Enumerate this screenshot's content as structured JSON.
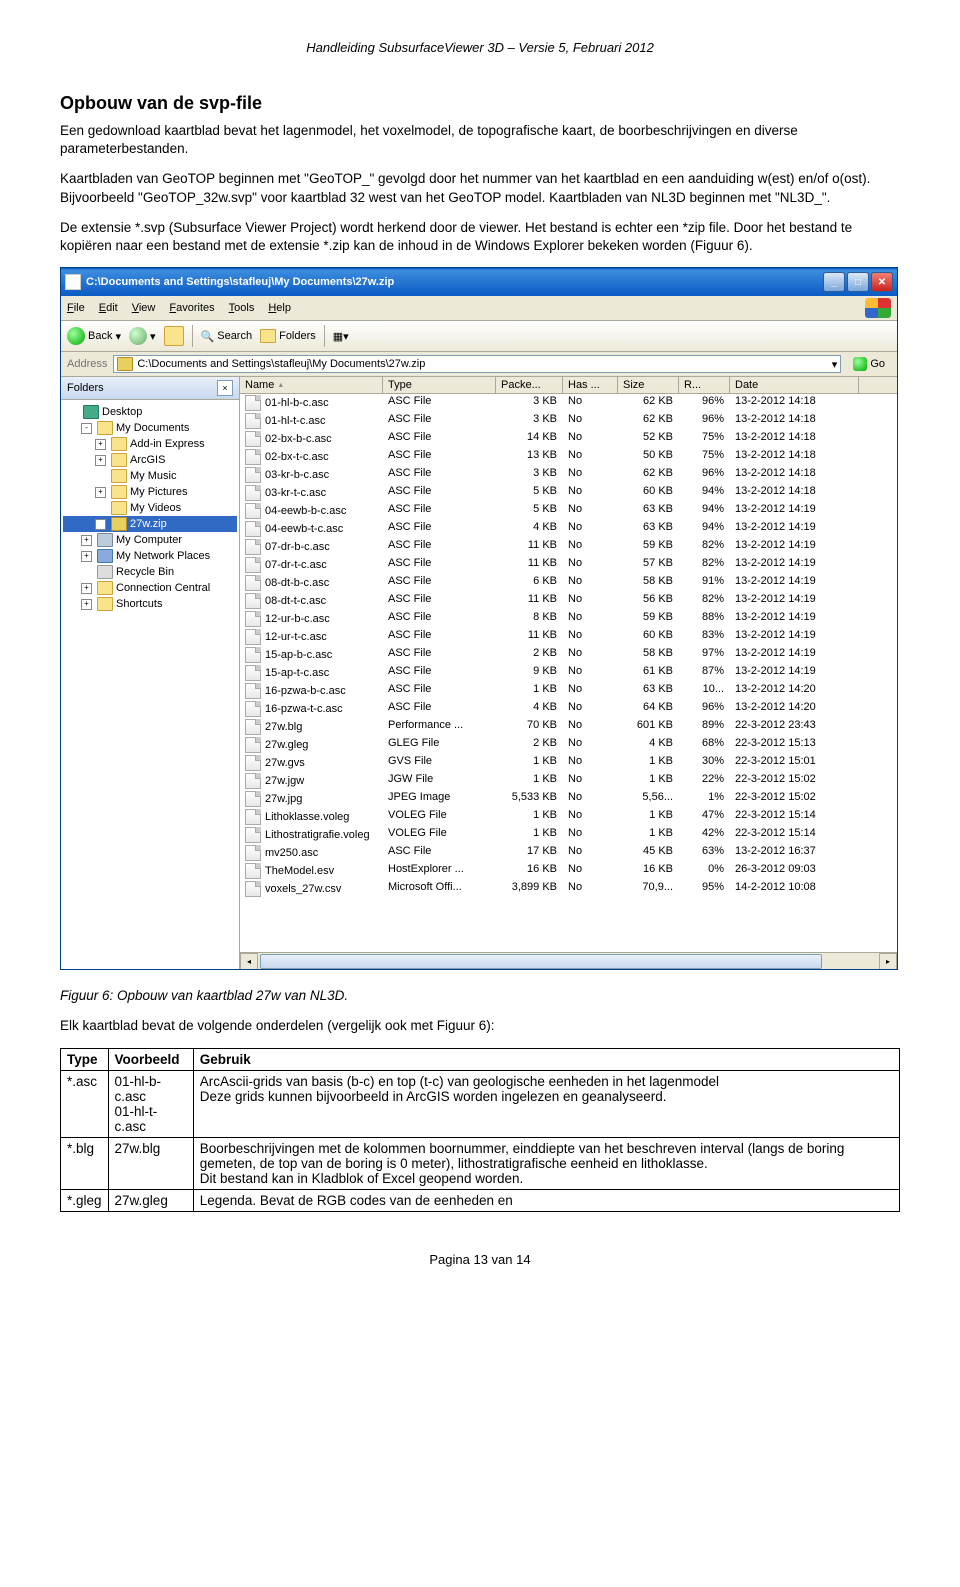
{
  "doc_header": "Handleiding SubsurfaceViewer 3D – Versie 5, Februari 2012",
  "heading": "Opbouw van de svp-file",
  "para1": "Een gedownload kaartblad bevat het lagenmodel, het voxelmodel, de topografische kaart, de boorbeschrijvingen en diverse parameterbestanden.",
  "para2": "Kaartbladen van GeoTOP beginnen met \"GeoTOP_\" gevolgd door het nummer van het kaartblad en een aanduiding w(est) en/of o(ost). Bijvoorbeeld \"GeoTOP_32w.svp\" voor kaartblad 32 west van het GeoTOP model. Kaartbladen van NL3D beginnen met \"NL3D_\".",
  "para3": "De extensie *.svp (Subsurface Viewer Project) wordt herkend door de viewer. Het bestand is echter een *zip file. Door het bestand te kopiëren naar een bestand met de extensie *.zip kan de inhoud in de Windows Explorer bekeken worden (Figuur 6).",
  "explorer": {
    "title": "C:\\Documents and Settings\\stafleuj\\My Documents\\27w.zip",
    "menu": [
      "File",
      "Edit",
      "View",
      "Favorites",
      "Tools",
      "Help"
    ],
    "toolbar_back": "Back",
    "toolbar_search": "Search",
    "toolbar_folders": "Folders",
    "address_label": "Address",
    "address_value": "C:\\Documents and Settings\\stafleuj\\My Documents\\27w.zip",
    "go_label": "Go",
    "folders_pane_title": "Folders",
    "tree": [
      {
        "d": 1,
        "exp": "",
        "ico": "desk",
        "label": "Desktop"
      },
      {
        "d": 2,
        "exp": "-",
        "ico": "f",
        "label": "My Documents"
      },
      {
        "d": 3,
        "exp": "+",
        "ico": "f",
        "label": "Add-in Express"
      },
      {
        "d": 3,
        "exp": "+",
        "ico": "f",
        "label": "ArcGIS"
      },
      {
        "d": 3,
        "exp": "",
        "ico": "f",
        "label": "My Music"
      },
      {
        "d": 3,
        "exp": "+",
        "ico": "f",
        "label": "My Pictures"
      },
      {
        "d": 3,
        "exp": "",
        "ico": "f",
        "label": "My Videos"
      },
      {
        "d": 3,
        "exp": "+",
        "ico": "zip",
        "label": "27w.zip",
        "sel": true
      },
      {
        "d": 2,
        "exp": "+",
        "ico": "comp",
        "label": "My Computer"
      },
      {
        "d": 2,
        "exp": "+",
        "ico": "net",
        "label": "My Network Places"
      },
      {
        "d": 2,
        "exp": "",
        "ico": "bin",
        "label": "Recycle Bin"
      },
      {
        "d": 2,
        "exp": "+",
        "ico": "f",
        "label": "Connection Central"
      },
      {
        "d": 2,
        "exp": "+",
        "ico": "f",
        "label": "Shortcuts"
      }
    ],
    "columns": [
      "Name",
      "Type",
      "Packe...",
      "Has ...",
      "Size",
      "R...",
      "Date"
    ],
    "files": [
      {
        "n": "01-hl-b-c.asc",
        "t": "ASC File",
        "p": "3 KB",
        "h": "No",
        "s": "62 KB",
        "r": "96%",
        "d": "13-2-2012 14:18"
      },
      {
        "n": "01-hl-t-c.asc",
        "t": "ASC File",
        "p": "3 KB",
        "h": "No",
        "s": "62 KB",
        "r": "96%",
        "d": "13-2-2012 14:18"
      },
      {
        "n": "02-bx-b-c.asc",
        "t": "ASC File",
        "p": "14 KB",
        "h": "No",
        "s": "52 KB",
        "r": "75%",
        "d": "13-2-2012 14:18"
      },
      {
        "n": "02-bx-t-c.asc",
        "t": "ASC File",
        "p": "13 KB",
        "h": "No",
        "s": "50 KB",
        "r": "75%",
        "d": "13-2-2012 14:18"
      },
      {
        "n": "03-kr-b-c.asc",
        "t": "ASC File",
        "p": "3 KB",
        "h": "No",
        "s": "62 KB",
        "r": "96%",
        "d": "13-2-2012 14:18"
      },
      {
        "n": "03-kr-t-c.asc",
        "t": "ASC File",
        "p": "5 KB",
        "h": "No",
        "s": "60 KB",
        "r": "94%",
        "d": "13-2-2012 14:18"
      },
      {
        "n": "04-eewb-b-c.asc",
        "t": "ASC File",
        "p": "5 KB",
        "h": "No",
        "s": "63 KB",
        "r": "94%",
        "d": "13-2-2012 14:19"
      },
      {
        "n": "04-eewb-t-c.asc",
        "t": "ASC File",
        "p": "4 KB",
        "h": "No",
        "s": "63 KB",
        "r": "94%",
        "d": "13-2-2012 14:19"
      },
      {
        "n": "07-dr-b-c.asc",
        "t": "ASC File",
        "p": "11 KB",
        "h": "No",
        "s": "59 KB",
        "r": "82%",
        "d": "13-2-2012 14:19"
      },
      {
        "n": "07-dr-t-c.asc",
        "t": "ASC File",
        "p": "11 KB",
        "h": "No",
        "s": "57 KB",
        "r": "82%",
        "d": "13-2-2012 14:19"
      },
      {
        "n": "08-dt-b-c.asc",
        "t": "ASC File",
        "p": "6 KB",
        "h": "No",
        "s": "58 KB",
        "r": "91%",
        "d": "13-2-2012 14:19"
      },
      {
        "n": "08-dt-t-c.asc",
        "t": "ASC File",
        "p": "11 KB",
        "h": "No",
        "s": "56 KB",
        "r": "82%",
        "d": "13-2-2012 14:19"
      },
      {
        "n": "12-ur-b-c.asc",
        "t": "ASC File",
        "p": "8 KB",
        "h": "No",
        "s": "59 KB",
        "r": "88%",
        "d": "13-2-2012 14:19"
      },
      {
        "n": "12-ur-t-c.asc",
        "t": "ASC File",
        "p": "11 KB",
        "h": "No",
        "s": "60 KB",
        "r": "83%",
        "d": "13-2-2012 14:19"
      },
      {
        "n": "15-ap-b-c.asc",
        "t": "ASC File",
        "p": "2 KB",
        "h": "No",
        "s": "58 KB",
        "r": "97%",
        "d": "13-2-2012 14:19"
      },
      {
        "n": "15-ap-t-c.asc",
        "t": "ASC File",
        "p": "9 KB",
        "h": "No",
        "s": "61 KB",
        "r": "87%",
        "d": "13-2-2012 14:19"
      },
      {
        "n": "16-pzwa-b-c.asc",
        "t": "ASC File",
        "p": "1 KB",
        "h": "No",
        "s": "63 KB",
        "r": "10...",
        "d": "13-2-2012 14:20"
      },
      {
        "n": "16-pzwa-t-c.asc",
        "t": "ASC File",
        "p": "4 KB",
        "h": "No",
        "s": "64 KB",
        "r": "96%",
        "d": "13-2-2012 14:20"
      },
      {
        "n": "27w.blg",
        "t": "Performance ...",
        "p": "70 KB",
        "h": "No",
        "s": "601 KB",
        "r": "89%",
        "d": "22-3-2012 23:43"
      },
      {
        "n": "27w.gleg",
        "t": "GLEG File",
        "p": "2 KB",
        "h": "No",
        "s": "4 KB",
        "r": "68%",
        "d": "22-3-2012 15:13"
      },
      {
        "n": "27w.gvs",
        "t": "GVS File",
        "p": "1 KB",
        "h": "No",
        "s": "1 KB",
        "r": "30%",
        "d": "22-3-2012 15:01"
      },
      {
        "n": "27w.jgw",
        "t": "JGW File",
        "p": "1 KB",
        "h": "No",
        "s": "1 KB",
        "r": "22%",
        "d": "22-3-2012 15:02"
      },
      {
        "n": "27w.jpg",
        "t": "JPEG Image",
        "p": "5,533 KB",
        "h": "No",
        "s": "5,56...",
        "r": "1%",
        "d": "22-3-2012 15:02"
      },
      {
        "n": "Lithoklasse.voleg",
        "t": "VOLEG File",
        "p": "1 KB",
        "h": "No",
        "s": "1 KB",
        "r": "47%",
        "d": "22-3-2012 15:14"
      },
      {
        "n": "Lithostratigrafie.voleg",
        "t": "VOLEG File",
        "p": "1 KB",
        "h": "No",
        "s": "1 KB",
        "r": "42%",
        "d": "22-3-2012 15:14"
      },
      {
        "n": "mv250.asc",
        "t": "ASC File",
        "p": "17 KB",
        "h": "No",
        "s": "45 KB",
        "r": "63%",
        "d": "13-2-2012 16:37"
      },
      {
        "n": "TheModel.esv",
        "t": "HostExplorer ...",
        "p": "16 KB",
        "h": "No",
        "s": "16 KB",
        "r": "0%",
        "d": "26-3-2012 09:03"
      },
      {
        "n": "voxels_27w.csv",
        "t": "Microsoft Offi...",
        "p": "3,899 KB",
        "h": "No",
        "s": "70,9...",
        "r": "95%",
        "d": "14-2-2012 10:08"
      }
    ]
  },
  "caption": "Figuur 6: Opbouw van kaartblad 27w van NL3D.",
  "compare_text": "Elk kaartblad bevat de volgende onderdelen (vergelijk ook met Figuur 6):",
  "table": {
    "headers": [
      "Type",
      "Voorbeeld",
      "Gebruik"
    ],
    "rows": [
      {
        "type": "*.asc",
        "ex": "01-hl-b-c.asc\n01-hl-t-c.asc",
        "use": "ArcAscii-grids van basis (b-c) en top (t-c) van geologische eenheden in het lagenmodel\nDeze grids kunnen bijvoorbeeld in ArcGIS worden ingelezen en geanalyseerd."
      },
      {
        "type": "*.blg",
        "ex": "27w.blg",
        "use": "Boorbeschrijvingen met de kolommen boornummer, einddiepte van het beschreven interval (langs de boring gemeten, de top van de boring is 0 meter), lithostratigrafische eenheid en lithoklasse.\nDit bestand kan in Kladblok of Excel geopend worden."
      },
      {
        "type": "*.gleg",
        "ex": "27w.gleg",
        "use": "Legenda. Bevat de RGB codes van de eenheden en"
      }
    ]
  },
  "footer": "Pagina 13 van 14"
}
